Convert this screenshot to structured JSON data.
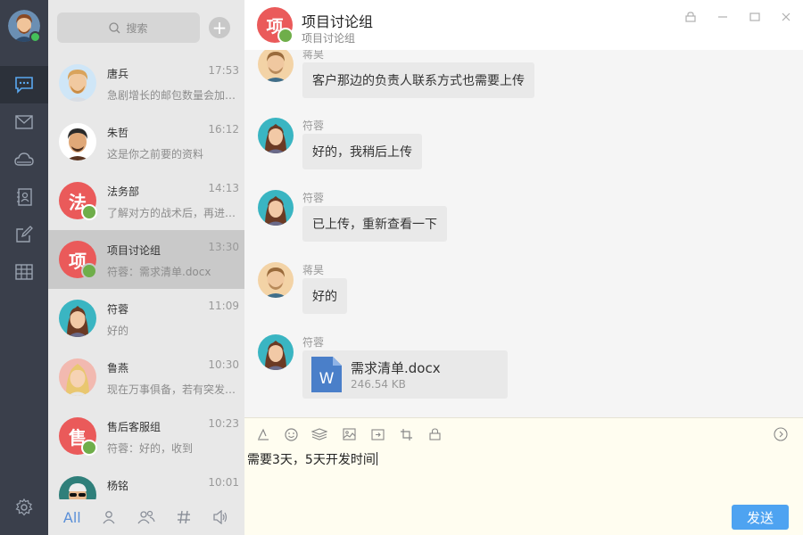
{
  "rail": {
    "items": [
      {
        "name": "messages",
        "icon": "chat-bubble-icon",
        "active": true
      },
      {
        "name": "mail",
        "icon": "mail-icon"
      },
      {
        "name": "cloud",
        "icon": "cloud-icon"
      },
      {
        "name": "contacts",
        "icon": "contacts-book-icon"
      },
      {
        "name": "notes",
        "icon": "edit-note-icon"
      },
      {
        "name": "table",
        "icon": "table-icon"
      }
    ],
    "settings_icon": "gear-icon"
  },
  "search": {
    "placeholder": "搜索"
  },
  "conversations": [
    {
      "name": "唐兵",
      "time": "17:53",
      "preview": "急剧增长的邮包数量会加剧现有困难",
      "avatar": "male-blond"
    },
    {
      "name": "朱哲",
      "time": "16:12",
      "preview": "这是你之前要的资料",
      "avatar": "male-dark"
    },
    {
      "name": "法务部",
      "time": "14:13",
      "preview": "了解对方的战术后，再进行下一步",
      "avatar_text": "法"
    },
    {
      "name": "项目讨论组",
      "time": "13:30",
      "preview": "符蓉：需求清单.docx",
      "avatar_text": "项",
      "selected": true
    },
    {
      "name": "符蓉",
      "time": "11:09",
      "preview": "好的",
      "avatar": "female-brown"
    },
    {
      "name": "鲁燕",
      "time": "10:30",
      "preview": "现在万事俱备，若有突发状况再说",
      "avatar": "female-blonde"
    },
    {
      "name": "售后客服组",
      "time": "10:23",
      "preview": "符蓉：好的，收到",
      "avatar_text": "售"
    },
    {
      "name": "杨铭",
      "time": "10:01",
      "preview": "",
      "avatar": "male-glasses"
    }
  ],
  "tabs": [
    {
      "label": "All",
      "icon": ""
    },
    {
      "label": "",
      "icon": "person-icon"
    },
    {
      "label": "",
      "icon": "group-icon"
    },
    {
      "label": "",
      "icon": "hash-icon"
    },
    {
      "label": "",
      "icon": "speaker-icon"
    }
  ],
  "chat": {
    "title": "项目讨论组",
    "subtitle": "项目讨论组",
    "avatar_text": "项",
    "messages": [
      {
        "sender": "蒋昊",
        "text": "客户那边的负责人联系方式也需要上传",
        "avatar": "male-beard"
      },
      {
        "sender": "符蓉",
        "text": "好的，我稍后上传",
        "avatar": "female-brown"
      },
      {
        "sender": "符蓉",
        "text": "已上传，重新查看一下",
        "avatar": "female-brown"
      },
      {
        "sender": "蒋昊",
        "text": "好的",
        "avatar": "male-beard"
      },
      {
        "sender": "符蓉",
        "file": {
          "name": "需求清单.docx",
          "size": "246.54 KB"
        },
        "avatar": "female-brown"
      }
    ],
    "input_text": "需要3天，5天开发时间",
    "send_label": "发送"
  },
  "colors": {
    "accent": "#4ea3f1",
    "group_avatar": "#ea5a5a",
    "rail": "#3a3f4b",
    "online": "#44c05a"
  }
}
